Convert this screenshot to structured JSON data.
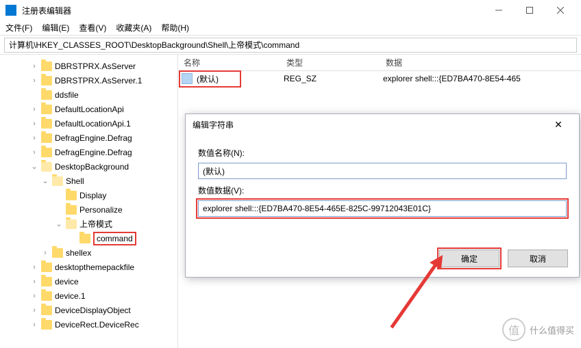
{
  "titlebar": {
    "title": "注册表编辑器"
  },
  "menu": {
    "file": "文件(F)",
    "edit": "编辑(E)",
    "view": "查看(V)",
    "fav": "收藏夹(A)",
    "help": "帮助(H)"
  },
  "address": {
    "path": "计算机\\HKEY_CLASSES_ROOT\\DesktopBackground\\Shell\\上帝模式\\command"
  },
  "list": {
    "headers": {
      "name": "名称",
      "type": "类型",
      "data": "数据"
    },
    "row": {
      "name": "(默认)",
      "type": "REG_SZ",
      "data": "explorer shell:::{ED7BA470-8E54-465"
    }
  },
  "tree": {
    "items": [
      {
        "lvl": 1,
        "chev": "›",
        "label": "DBRSTPRX.AsServer"
      },
      {
        "lvl": 1,
        "chev": "›",
        "label": "DBRSTPRX.AsServer.1"
      },
      {
        "lvl": 1,
        "chev": "",
        "label": "ddsfile"
      },
      {
        "lvl": 1,
        "chev": "›",
        "label": "DefaultLocationApi"
      },
      {
        "lvl": 1,
        "chev": "›",
        "label": "DefaultLocationApi.1"
      },
      {
        "lvl": 1,
        "chev": "›",
        "label": "DefragEngine.Defrag"
      },
      {
        "lvl": 1,
        "chev": "›",
        "label": "DefragEngine.Defrag"
      },
      {
        "lvl": 1,
        "chev": "⌄",
        "label": "DesktopBackground",
        "open": true
      },
      {
        "lvl": 2,
        "chev": "⌄",
        "label": "Shell",
        "open": true
      },
      {
        "lvl": 3,
        "chev": "",
        "label": "Display"
      },
      {
        "lvl": 3,
        "chev": "",
        "label": "Personalize"
      },
      {
        "lvl": 3,
        "chev": "⌄",
        "label": "上帝模式",
        "open": true
      },
      {
        "lvl": 4,
        "chev": "",
        "label": "command",
        "hl": true
      },
      {
        "lvl": 2,
        "chev": "›",
        "label": "shellex"
      },
      {
        "lvl": 1,
        "chev": "›",
        "label": "desktopthemepackfile"
      },
      {
        "lvl": 1,
        "chev": "›",
        "label": "device"
      },
      {
        "lvl": 1,
        "chev": "›",
        "label": "device.1"
      },
      {
        "lvl": 1,
        "chev": "›",
        "label": "DeviceDisplayObject"
      },
      {
        "lvl": 1,
        "chev": "›",
        "label": "DeviceRect.DeviceRec"
      }
    ]
  },
  "dialog": {
    "title": "编辑字符串",
    "name_label": "数值名称(N):",
    "name_value": "(默认)",
    "data_label": "数值数据(V):",
    "data_value": "explorer shell:::{ED7BA470-8E54-465E-825C-99712043E01C}",
    "ok": "确定",
    "cancel": "取消"
  },
  "watermark": {
    "text": "什么值得买",
    "icon": "值"
  }
}
